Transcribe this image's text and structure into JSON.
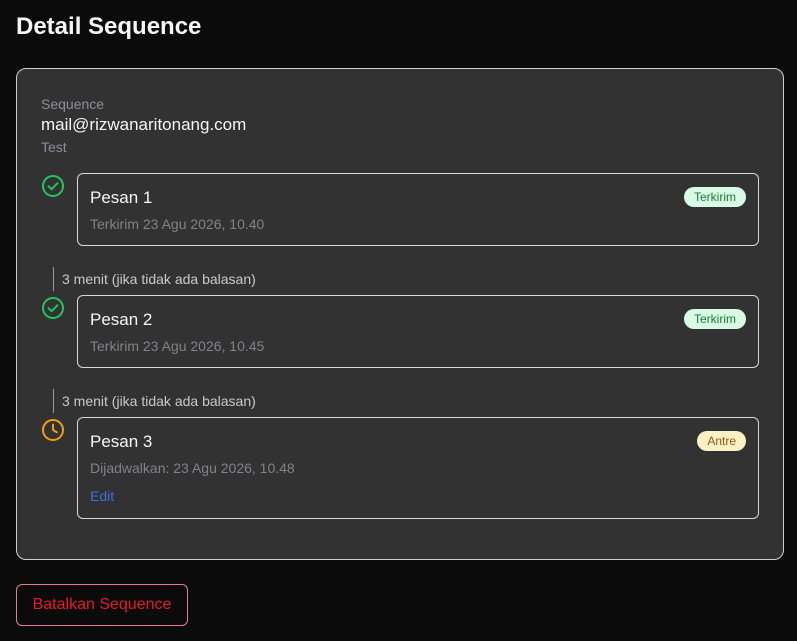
{
  "page": {
    "title": "Detail Sequence"
  },
  "sequence": {
    "label": "Sequence",
    "email": "mail@rizwanaritonang.com",
    "description": "Test"
  },
  "messages": [
    {
      "title": "Pesan 1",
      "status": "Terkirim",
      "meta": "Terkirim 23 Agu 2026, 10.40",
      "status_icon": "check-circle-icon"
    },
    {
      "title": "Pesan 2",
      "status": "Terkirim",
      "meta": "Terkirim 23 Agu 2026, 10.45",
      "status_icon": "check-circle-icon"
    },
    {
      "title": "Pesan 3",
      "status": "Antre",
      "meta": "Dijadwalkan: 23 Agu 2026, 10.48",
      "edit_label": "Edit",
      "status_icon": "clock-icon"
    }
  ],
  "delays": [
    "3 menit (jika tidak ada balasan)",
    "3 menit (jika tidak ada balasan)"
  ],
  "actions": {
    "cancel_label": "Batalkan Sequence"
  },
  "colors": {
    "sent": "#22c55e",
    "queued": "#f59e0b",
    "danger": "#e8192c",
    "link": "#3b6fe6"
  }
}
